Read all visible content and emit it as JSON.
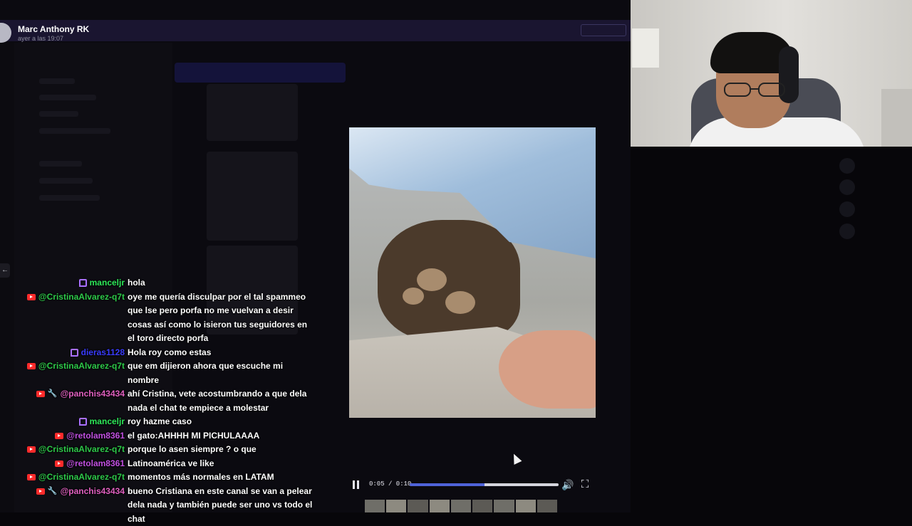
{
  "post": {
    "author": "Marc Anthony RK",
    "timestamp": "ayer a las 19:07"
  },
  "player": {
    "time": "0:05 / 0:10",
    "progress": 0.5,
    "pause_icon": "pause-icon",
    "volume_icon": "volume-icon",
    "fullscreen_icon": "fullscreen-icon"
  },
  "colors": {
    "twitch": "#a970ff",
    "youtube": "#ff2b2b",
    "progress": "#4f63d9"
  },
  "chat": [
    {
      "platform": "twitch",
      "user": "manceljr",
      "user_color": "#2ee85a",
      "text": "hola"
    },
    {
      "platform": "youtube",
      "user": "@CristinaAlvarez-q7t",
      "user_color": "#2ec94a",
      "text": "oye me quería disculpar por el tal spammeo que lse pero porfa no me vuelvan a desir cosas así como lo isieron tus seguidores en el toro directo porfa"
    },
    {
      "platform": "twitch",
      "user": "dieras1128",
      "user_color": "#3a3cff",
      "text": "Hola roy como estas"
    },
    {
      "platform": "youtube",
      "user": "@CristinaAlvarez-q7t",
      "user_color": "#2ec94a",
      "text": "que em dijieron ahora que escuche mi nombre"
    },
    {
      "platform": "youtube",
      "moderator": true,
      "user": "@panchis43434",
      "user_color": "#e060c0",
      "text": "ahí Cristina, vete acostumbrando a que dela nada el chat te empiece a molestar"
    },
    {
      "platform": "twitch",
      "user": "manceljr",
      "user_color": "#2ee85a",
      "text": "roy hazme caso"
    },
    {
      "platform": "youtube",
      "user": "@retolam8361",
      "user_color": "#c050e0",
      "text": "el gato:AHHHH MI PICHULAAAA"
    },
    {
      "platform": "youtube",
      "user": "@CristinaAlvarez-q7t",
      "user_color": "#2ec94a",
      "text": "porque lo asen siempre ? o que"
    },
    {
      "platform": "youtube",
      "user": "@retolam8361",
      "user_color": "#c050e0",
      "text": "Latinoamérica ve like"
    },
    {
      "platform": "youtube",
      "user": "@CristinaAlvarez-q7t",
      "user_color": "#2ec94a",
      "text": "momentos más normales en LATAM"
    },
    {
      "platform": "youtube",
      "moderator": true,
      "user": "@panchis43434",
      "user_color": "#e060c0",
      "text": "bueno Cristiana en este canal se van a pelear dela nada y también puede ser uno vs todo el chat"
    }
  ]
}
